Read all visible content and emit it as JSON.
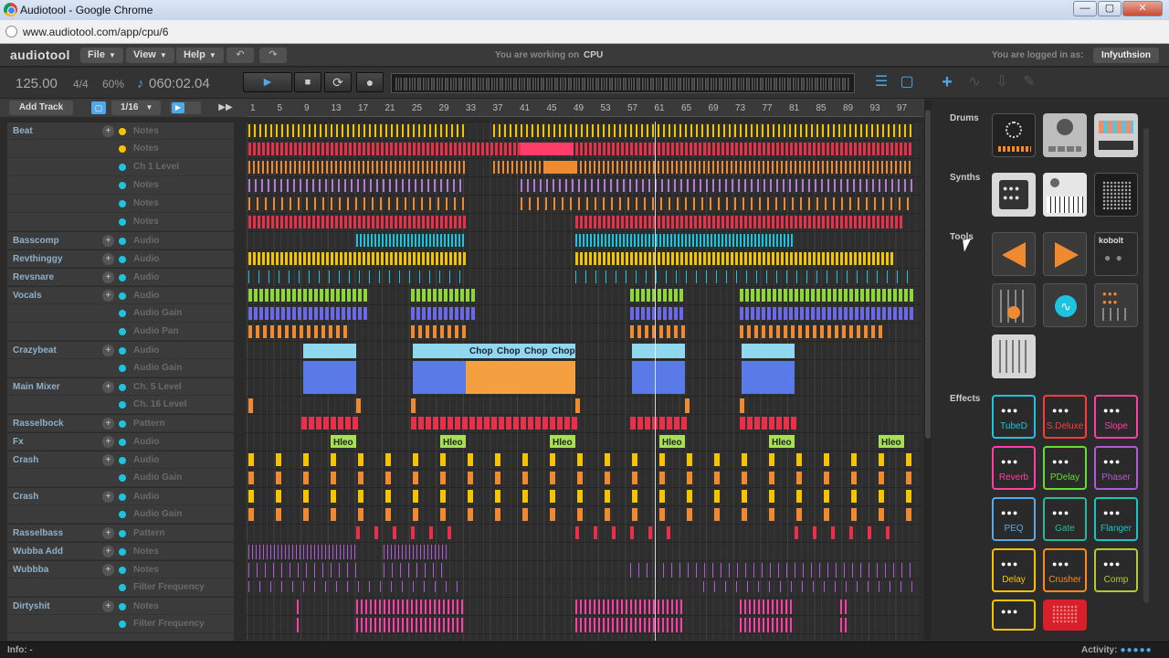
{
  "window": {
    "title": "Audiotool - Google Chrome",
    "minimize": "—",
    "maximize": "▢",
    "close": "✕"
  },
  "browser": {
    "url": "www.audiotool.com/app/cpu/6"
  },
  "header": {
    "logo": "audiotool",
    "menus": [
      {
        "label": "File"
      },
      {
        "label": "View"
      },
      {
        "label": "Help"
      }
    ],
    "undo_icon": "↶",
    "redo_icon": "↷",
    "working_on_label": "You are working on",
    "working_on_value": "CPU",
    "logged_in_label": "You are logged in as:",
    "user": "Infyuthsion"
  },
  "transport": {
    "tempo": "125.00",
    "signature": "4/4",
    "swing": "60%",
    "note_icon": "♪",
    "time": "060:02.04",
    "play_icon": "▶",
    "stop_icon": "■",
    "loop_icon": "⟳",
    "record_icon": "●"
  },
  "toolbar": {
    "add_track": "Add Track",
    "grid": "1/16",
    "ff_icon": "▶▶"
  },
  "ruler": [
    "1",
    "5",
    "9",
    "13",
    "17",
    "21",
    "25",
    "29",
    "33",
    "37",
    "41",
    "45",
    "49",
    "53",
    "57",
    "61",
    "65",
    "69",
    "73",
    "77",
    "81",
    "85",
    "89",
    "93",
    "97"
  ],
  "tracks": [
    {
      "name": "Beat",
      "lane": "Notes",
      "plus": true,
      "dot": "yellow"
    },
    {
      "name": "",
      "lane": "Notes",
      "plus": false,
      "dot": "yellow"
    },
    {
      "name": "",
      "lane": "Ch 1 Level",
      "plus": false,
      "dot": "cyan"
    },
    {
      "name": "",
      "lane": "Notes",
      "plus": false,
      "dot": "cyan"
    },
    {
      "name": "",
      "lane": "Notes",
      "plus": false,
      "dot": "cyan"
    },
    {
      "name": "",
      "lane": "Notes",
      "plus": false,
      "dot": "cyan"
    },
    {
      "name": "Basscomp",
      "lane": "Audio",
      "plus": true,
      "dot": "cyan"
    },
    {
      "name": "Revthinggy",
      "lane": "Audio",
      "plus": true,
      "dot": "cyan"
    },
    {
      "name": "Revsnare",
      "lane": "Audio",
      "plus": true,
      "dot": "cyan"
    },
    {
      "name": "Vocals",
      "lane": "Audio",
      "plus": true,
      "dot": "cyan"
    },
    {
      "name": "",
      "lane": "Audio Gain",
      "plus": false,
      "dot": "cyan"
    },
    {
      "name": "",
      "lane": "Audio Pan",
      "plus": false,
      "dot": "cyan"
    },
    {
      "name": "Crazybeat",
      "lane": "Audio",
      "plus": true,
      "dot": "cyan"
    },
    {
      "name": "",
      "lane": "Audio Gain",
      "plus": false,
      "dot": "cyan"
    },
    {
      "name": "Main Mixer",
      "lane": "Ch. 5 Level",
      "plus": true,
      "dot": "cyan"
    },
    {
      "name": "",
      "lane": "Ch. 16 Level",
      "plus": false,
      "dot": "cyan"
    },
    {
      "name": "Rasselbock",
      "lane": "Pattern",
      "plus": true,
      "dot": "cyan"
    },
    {
      "name": "Fx",
      "lane": "Audio",
      "plus": true,
      "dot": "cyan"
    },
    {
      "name": "Crash",
      "lane": "Audio",
      "plus": true,
      "dot": "cyan"
    },
    {
      "name": "",
      "lane": "Audio Gain",
      "plus": false,
      "dot": "cyan"
    },
    {
      "name": "Crash",
      "lane": "Audio",
      "plus": true,
      "dot": "cyan"
    },
    {
      "name": "",
      "lane": "Audio Gain",
      "plus": false,
      "dot": "cyan"
    },
    {
      "name": "Rasselbass",
      "lane": "Pattern",
      "plus": true,
      "dot": "cyan"
    },
    {
      "name": "Wubba Add",
      "lane": "Notes",
      "plus": true,
      "dot": "cyan"
    },
    {
      "name": "Wubbba",
      "lane": "Notes",
      "plus": true,
      "dot": "cyan"
    },
    {
      "name": "",
      "lane": "Filter Frequency",
      "plus": false,
      "dot": "cyan"
    },
    {
      "name": "Dirtyshit",
      "lane": "Notes",
      "plus": true,
      "dot": "cyan"
    },
    {
      "name": "",
      "lane": "Filter Frequency",
      "plus": false,
      "dot": "cyan"
    }
  ],
  "clip_labels": {
    "chop": "Chop",
    "hleo": "Hleo"
  },
  "panel": {
    "categories": {
      "drums": "Drums",
      "synths": "Synths",
      "tools": "Tools",
      "effects": "Effects"
    },
    "tool_label": "kobolt",
    "effects": [
      {
        "label": "TubeD",
        "color": "#1ec3e0"
      },
      {
        "label": "S.Deluxe",
        "color": "#ff3b3b"
      },
      {
        "label": "Slope",
        "color": "#ff3da6"
      },
      {
        "label": "Reverb",
        "color": "#ff3da6"
      },
      {
        "label": "PDelay",
        "color": "#66dd33"
      },
      {
        "label": "Phaser",
        "color": "#b05ad8"
      },
      {
        "label": "PEQ",
        "color": "#5aa8e8"
      },
      {
        "label": "Gate",
        "color": "#2fb89a"
      },
      {
        "label": "Flanger",
        "color": "#1ec3c0"
      },
      {
        "label": "Delay",
        "color": "#f5c400"
      },
      {
        "label": "Crusher",
        "color": "#ff8a1a"
      },
      {
        "label": "Comp",
        "color": "#b8c830"
      }
    ]
  },
  "status": {
    "info": "Info: -",
    "activity": "Activity:",
    "activity_dots": "●●●●●"
  }
}
